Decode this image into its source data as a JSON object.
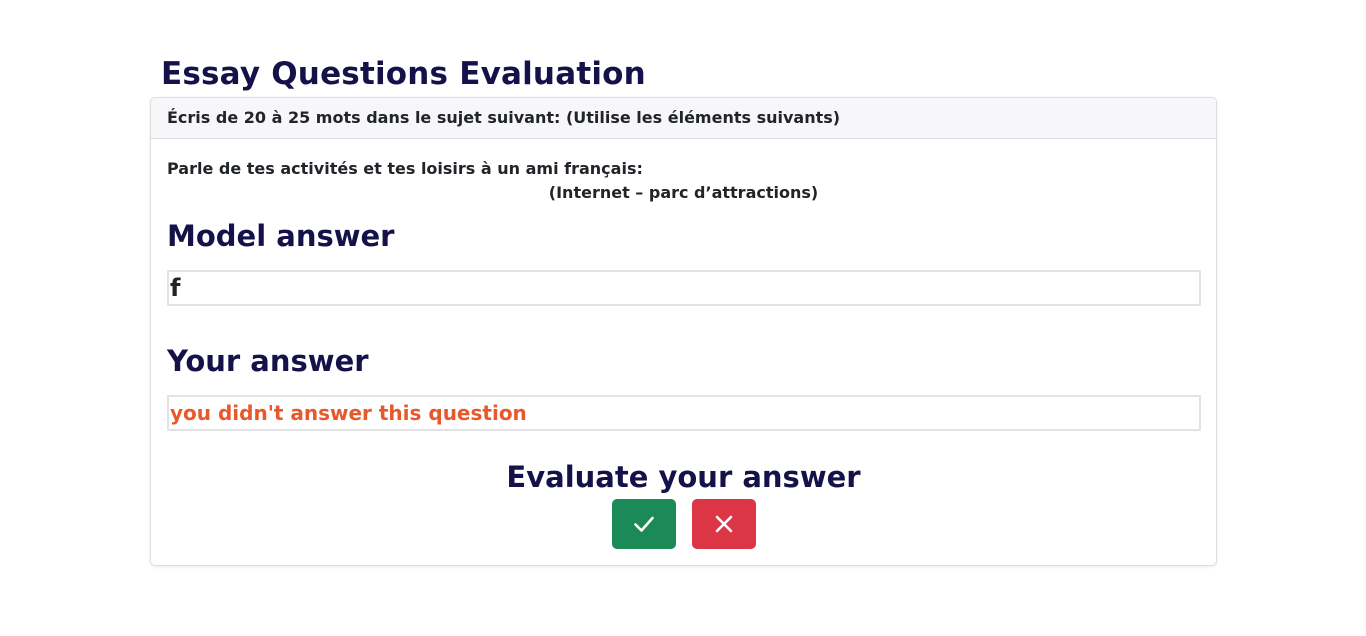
{
  "page": {
    "title": "Essay Questions Evaluation"
  },
  "question": {
    "instruction": "Écris de 20 à 25 mots dans le sujet suivant: (Utilise les éléments suivants)",
    "prompt": "Parle de tes activités et tes loisirs à un ami français:",
    "elements": "(Internet – parc d’attractions)"
  },
  "model_answer": {
    "heading": "Model answer",
    "text": "f"
  },
  "your_answer": {
    "heading": "Your answer",
    "text": "you didn't answer this question"
  },
  "evaluation": {
    "heading": "Evaluate your answer",
    "correct_icon": "check-icon",
    "wrong_icon": "x-icon"
  },
  "colors": {
    "heading": "#15124a",
    "answer_missing": "#e8582a",
    "correct_button": "#1b8a56",
    "wrong_button": "#dc3545"
  }
}
